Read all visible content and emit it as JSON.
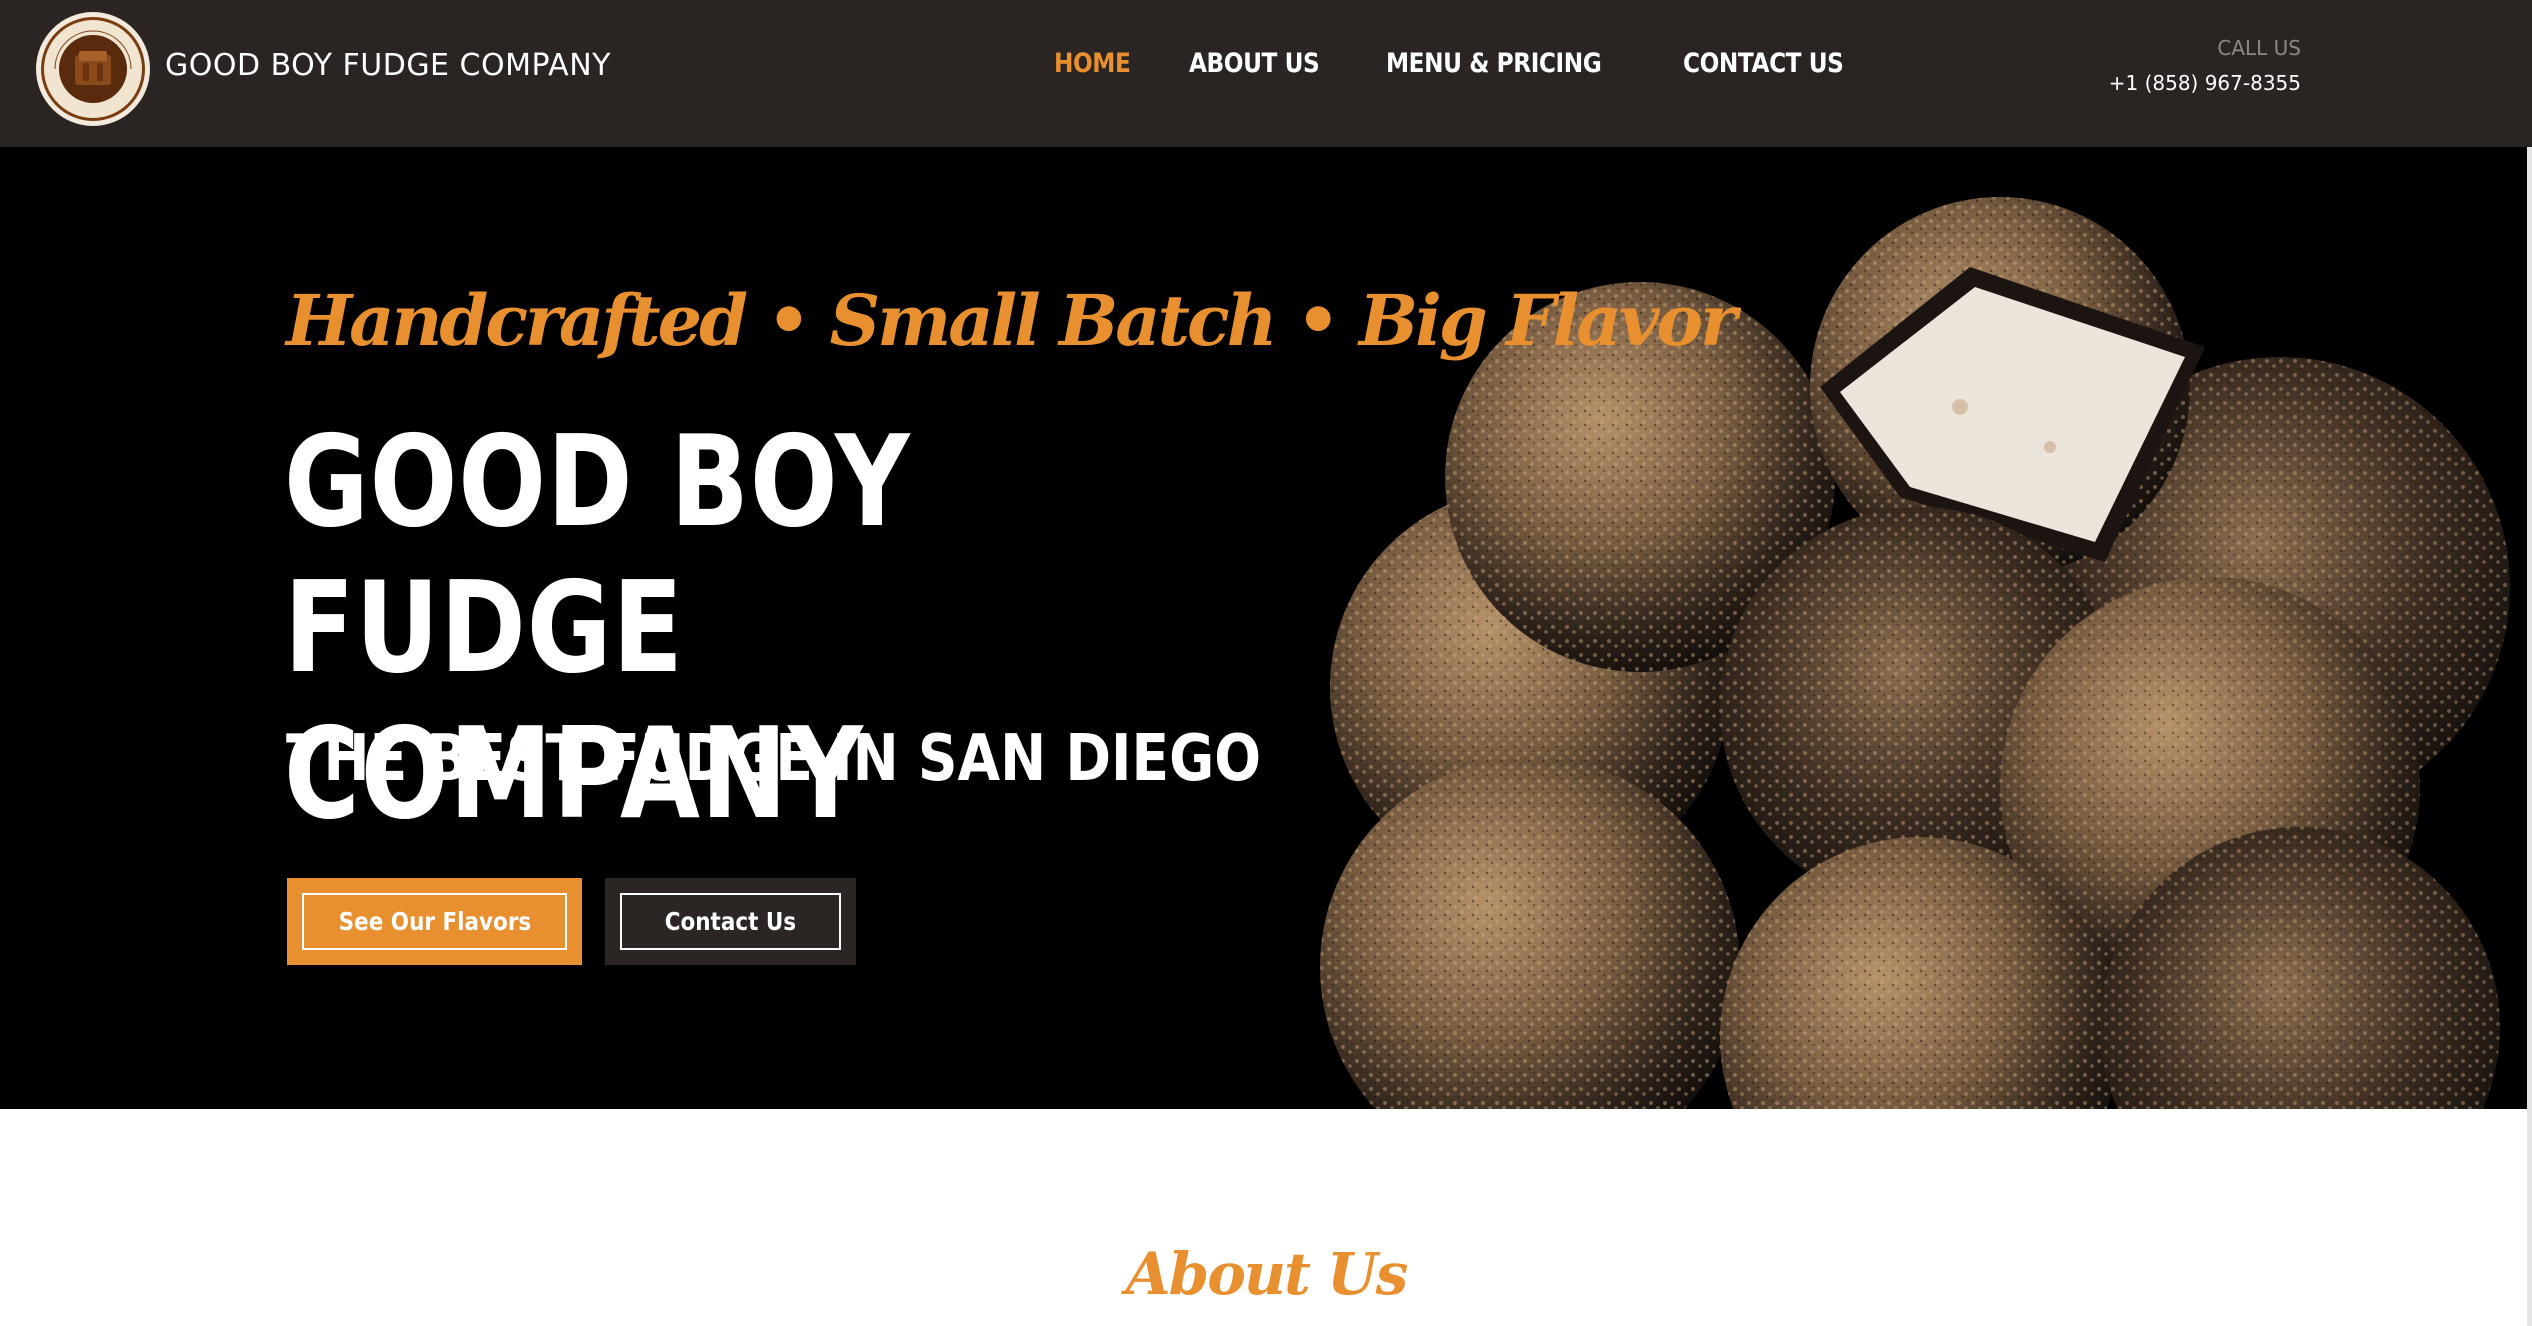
{
  "brand": {
    "name": "GOOD BOY FUDGE COMPANY",
    "logo_text_top": "GOOD BOY",
    "logo_text_bottom": "FUDGE COMPANY"
  },
  "nav": {
    "items": [
      {
        "label": "HOME",
        "active": true
      },
      {
        "label": "ABOUT US",
        "active": false
      },
      {
        "label": "MENU & PRICING",
        "active": false
      },
      {
        "label": "CONTACT US",
        "active": false
      }
    ]
  },
  "contact": {
    "call_label": "CALL US",
    "phone": "+1 (858) 967-8355"
  },
  "hero": {
    "tagline": "Handcrafted • Small Batch • Big Flavor",
    "title": "GOOD BOY FUDGE COMPANY",
    "subtitle": "THE BEST FUDGE IN SAN DIEGO",
    "primary_button": "See Our Flavors",
    "secondary_button": "Contact Us",
    "image_icon": "fudge-balls-image"
  },
  "about": {
    "heading": "About Us"
  },
  "colors": {
    "accent": "#e8902f",
    "header_bg": "#2a2522",
    "hero_bg": "#000000",
    "dark_button": "#2b2623"
  }
}
